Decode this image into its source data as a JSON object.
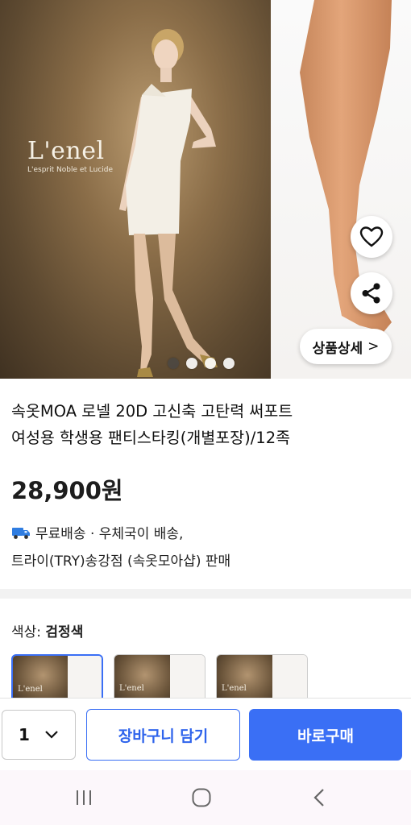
{
  "hero": {
    "brand_logo": "L'enel",
    "brand_tagline": "L'esprit Noble et Lucide",
    "detail_button": "상품상세",
    "detail_chevron": ">",
    "dots_count": 4,
    "active_dot": 1,
    "icons": {
      "like": "heart-outline-icon",
      "share": "share-icon"
    }
  },
  "product": {
    "title_line1": "속옷MOA 로넬 20D 고신축 고탄력 써포트",
    "title_line2": "여성용 학생용 팬티스타킹(개별포장)/12족",
    "price": "28,900원",
    "shipping": "무료배송 · 우체국이 배송,",
    "seller": "트라이(TRY)송강점 (속옷모아샵) 판매",
    "shipping_icon": "truck-icon"
  },
  "options": {
    "color_label": "색상: ",
    "color_value": "검정색",
    "thumbnails": [
      {
        "label": "L'enel",
        "selected": true
      },
      {
        "label": "L'enel",
        "selected": false
      },
      {
        "label": "L'enel",
        "selected": false
      }
    ]
  },
  "bottom_bar": {
    "quantity": "1",
    "cart_label": "장바구니 담기",
    "buy_label": "바로구매",
    "accent_color": "#3a6ff5"
  },
  "system_nav": {
    "icons": [
      "recent-apps-icon",
      "home-icon",
      "back-icon"
    ]
  }
}
